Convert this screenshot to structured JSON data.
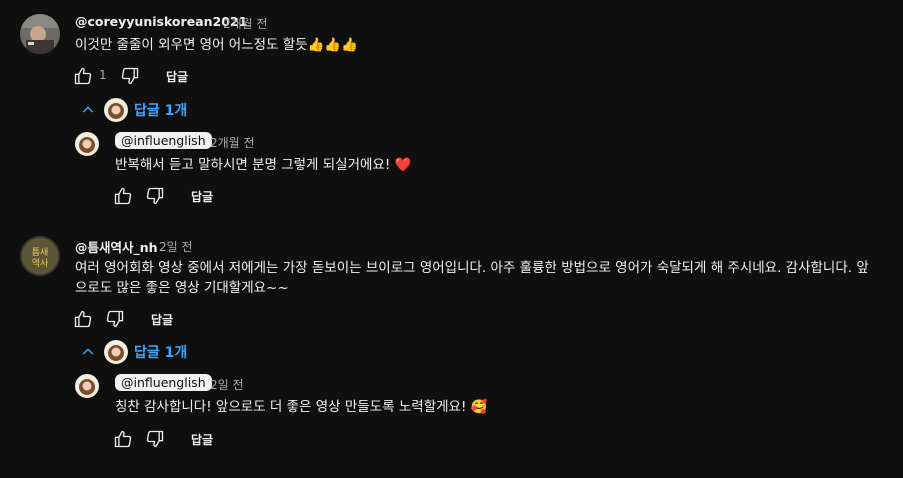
{
  "comments": [
    {
      "handle": "@coreyyuniskorean2021",
      "time": "2개월 전",
      "text": "이것만 줄줄이 외우면 영어 어느정도 할듯👍👍👍",
      "likes": "1",
      "reply_label": "답글",
      "replies_toggle": "답글 1개",
      "reply": {
        "handle": "@influenglish",
        "time": "2개월 전",
        "text": "반복해서 듣고 말하시면 분명 그렇게 되실거에요! ❤️",
        "reply_label": "답글"
      }
    },
    {
      "handle": "@틈새역사_nh",
      "time": "2일 전",
      "text_line1": "여러 영어회화 영상 중에서 저에게는 가장 돋보이는 브이로그 영어입니다. 아주 훌륭한 방법으로 영어가 숙달되게 해 주시네요. 감사합니다. 앞",
      "text_line2": "으로도 많은 좋은 영상 기대할게요~~",
      "reply_label": "답글",
      "replies_toggle": "답글 1개",
      "reply": {
        "handle": "@influenglish",
        "time": "2일 전",
        "text": "칭찬 감사합니다! 앞으로도 더 좋은 영상 만들도록 노력할게요! 🥰",
        "reply_label": "답글"
      }
    }
  ],
  "colors": {
    "background": "#0f0f0f",
    "link": "#3ea6ff",
    "text": "#f1f1f1",
    "secondary": "#aaaaaa"
  },
  "icons": [
    "thumb-up-icon",
    "thumb-down-icon",
    "chevron-up-icon",
    "avatar"
  ]
}
